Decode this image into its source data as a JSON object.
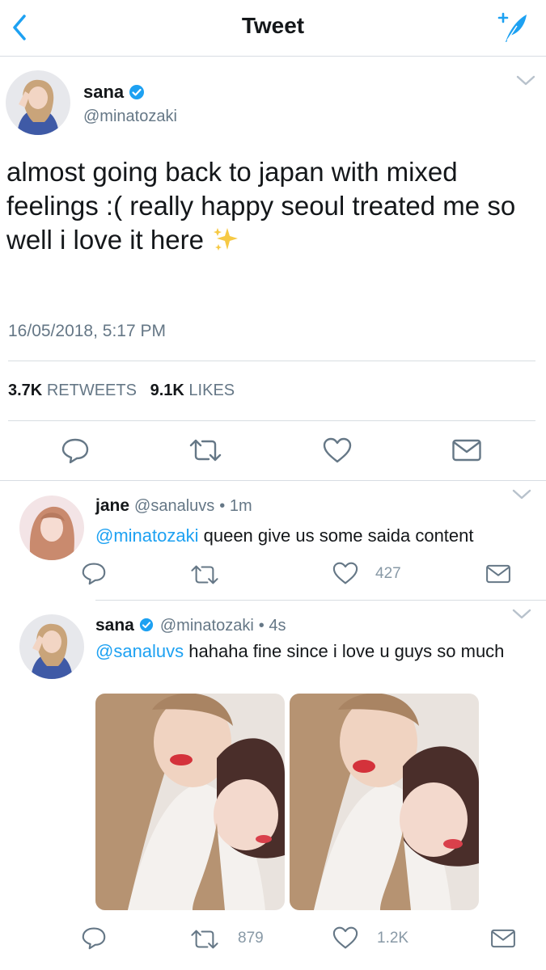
{
  "nav": {
    "title": "Tweet",
    "back_icon": "chevron-left-icon",
    "compose_icon": "compose-feather-icon",
    "accent": "#1da1f2"
  },
  "tweet": {
    "name": "sana",
    "handle": "@minatozaki",
    "text": "almost going back to japan with mixed feelings :( really happy seoul treated me so well i love it here",
    "emoji": "sparkles-icon",
    "timestamp": "16/05/2018, 5:17 PM",
    "retweets_count": "3.7K",
    "retweets_label": "RETWEETS",
    "likes_count": "9.1K",
    "likes_label": "LIKES"
  },
  "replies": [
    {
      "name": "jane",
      "handle": "@sanaluvs",
      "time": "• 1m",
      "mention": "@minatozaki",
      "text": " queen give us some saida content",
      "likes": "427"
    },
    {
      "name": "sana",
      "handle": "@minatozaki",
      "time": "• 4s",
      "mention": "@sanaluvs",
      "text": " hahaha fine since i love u guys so much",
      "retweets": "879",
      "likes": "1.2K"
    }
  ]
}
